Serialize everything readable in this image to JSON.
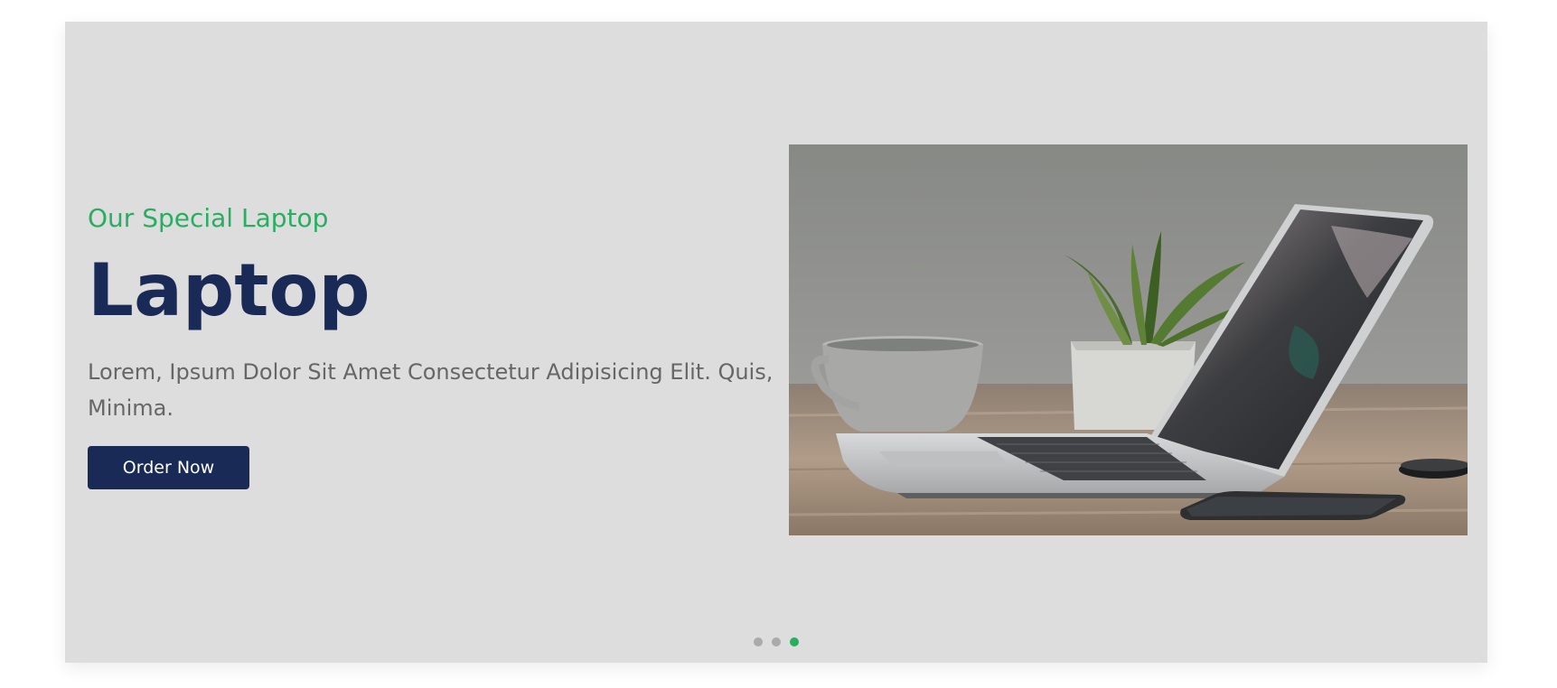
{
  "slide": {
    "subtitle": "Our Special Laptop",
    "title": "Laptop",
    "description": "Lorem, Ipsum Dolor Sit Amet Consectetur Adipisicing Elit. Quis, Minima.",
    "button_label": "Order Now"
  },
  "pagination": {
    "total": 3,
    "active_index": 2
  },
  "colors": {
    "accent": "#27ae60",
    "brand": "#192a56",
    "slide_background": "#dddddd"
  },
  "image": {
    "icon": "laptop-on-desk-photo"
  }
}
